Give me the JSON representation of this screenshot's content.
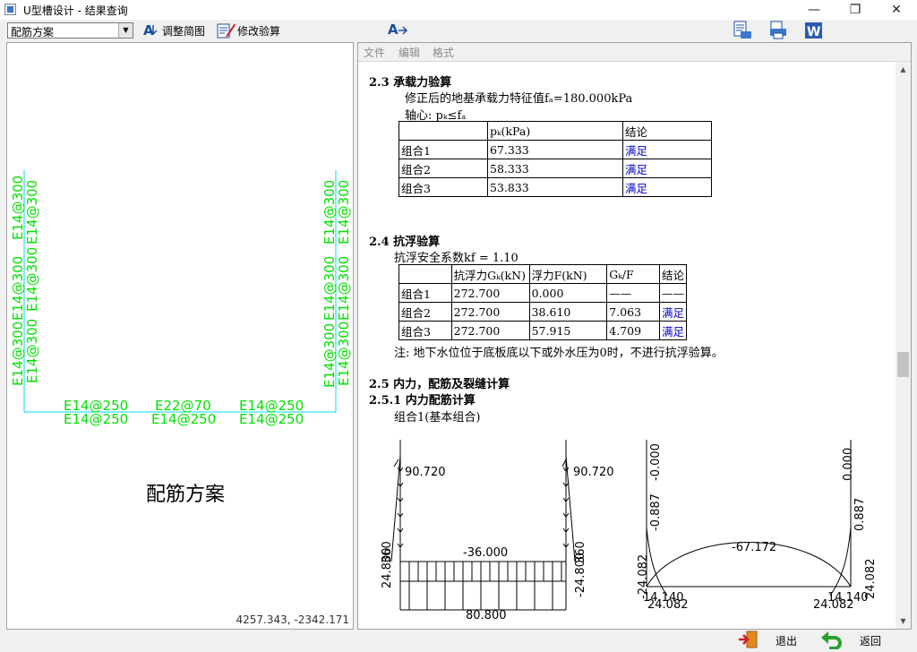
{
  "window": {
    "title": "U型槽设计 - 结果查询",
    "minimize": "—",
    "restore": "❐",
    "close": "✕"
  },
  "toolbar": {
    "combo_value": "配筋方案",
    "adjust_label": "调整简图",
    "modify_label": "修改验算"
  },
  "left": {
    "caption": "配筋方案",
    "coords": "4257.343, -2342.171",
    "rebar": {
      "wall_outer": "E14@300",
      "wall_inner": "E14@300",
      "bottom_top": [
        "E14@250",
        "E22@70",
        "E14@250"
      ],
      "bottom_bot": [
        "E14@250",
        "E14@250",
        "E14@250"
      ]
    }
  },
  "menu": {
    "file": "文件",
    "edit": "编辑",
    "format": "格式"
  },
  "doc": {
    "s23": {
      "heading": "2.3 承载力验算",
      "line1": "修正后的地基承载力特征值fₐ=180.000kPa",
      "line2": "轴心: pₖ≤fₐ",
      "headers": [
        "",
        "pₖ(kPa)",
        "结论"
      ],
      "rows": [
        [
          "组合1",
          "67.333",
          "满足"
        ],
        [
          "组合2",
          "58.333",
          "满足"
        ],
        [
          "组合3",
          "53.833",
          "满足"
        ]
      ]
    },
    "s24": {
      "heading": "2.4 抗浮验算",
      "line1": "抗浮安全系数kf = 1.10",
      "headers": [
        "",
        "抗浮力Gₖ(kN)",
        "浮力F(kN)",
        "Gₖ/F",
        "结论"
      ],
      "rows": [
        [
          "组合1",
          "272.700",
          "0.000",
          "——",
          "——"
        ],
        [
          "组合2",
          "272.700",
          "38.610",
          "7.063",
          "满足"
        ],
        [
          "组合3",
          "272.700",
          "57.915",
          "4.709",
          "满足"
        ]
      ],
      "note": "注: 地下水位位于底板底以下或外水压为0时，不进行抗浮验算。"
    },
    "s25": {
      "heading": "2.5 内力，配筋及裂缝计算",
      "sub": "2.5.1 内力配筋计算",
      "combo": "组合1(基本组合)"
    },
    "diagram_load": {
      "top_left": "90.720",
      "top_right": "90.720",
      "mid": "-36.000",
      "bottom": "80.800",
      "left_low": "24.800",
      "left_mid": "360",
      "right_low": "-24.800",
      "right_mid": "360"
    },
    "diagram_moment": {
      "top_left": "-0.000",
      "top_right": "0.000",
      "mid_left": "-0.887",
      "mid_right": "0.887",
      "arc": "-67.172",
      "bl1": "24.082",
      "br1": "24.082",
      "bl2": "14.140",
      "br2": "14.140",
      "l_low": "-24.082",
      "r_low": "24.082"
    }
  },
  "bottom": {
    "exit_label": "退出",
    "back_label": "返回"
  }
}
